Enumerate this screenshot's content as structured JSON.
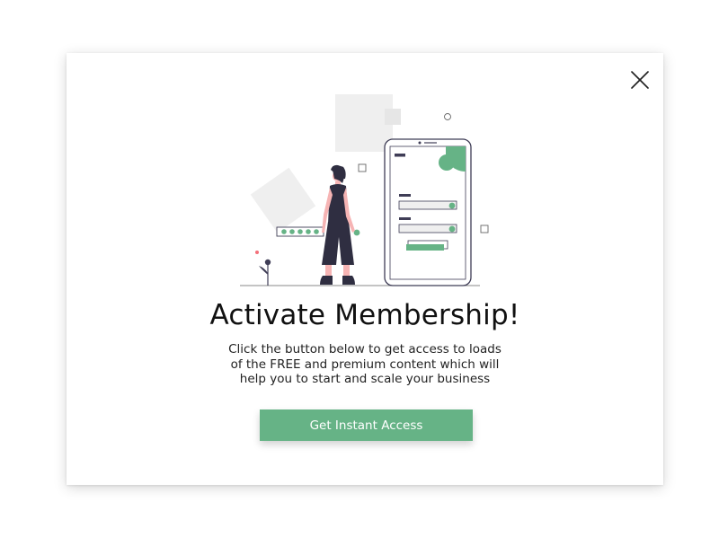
{
  "modal": {
    "title": "Activate Membership!",
    "description_lines": [
      "Click the button below to get access to loads",
      "of the FREE and premium content which will",
      "help you to start and scale your business"
    ],
    "cta_label": "Get Instant Access",
    "close_icon": "close-icon",
    "illustration": "woman-with-phone-signup-illustration"
  },
  "colors": {
    "accent": "#66b386",
    "illustration_gray": "#efefef",
    "illustration_dark": "#2f2e41",
    "accent_pink": "#f4707a"
  }
}
